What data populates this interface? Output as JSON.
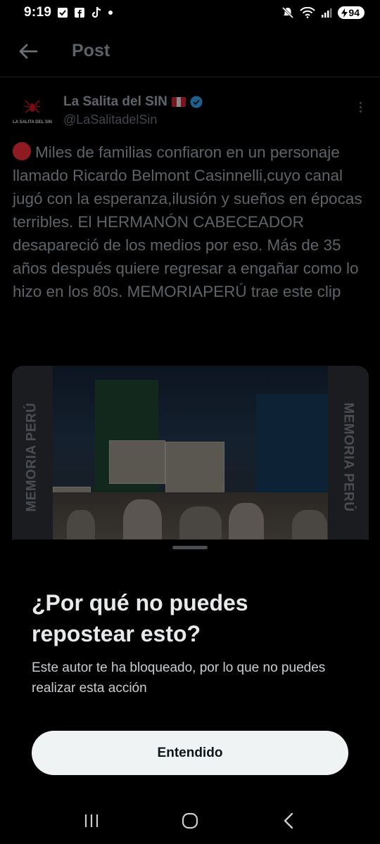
{
  "status_bar": {
    "time": "9:19",
    "battery": "94",
    "icons": [
      "check-box-icon",
      "facebook-icon",
      "tiktok-icon",
      "dot-icon",
      "mute-icon",
      "wifi-icon",
      "signal-icon",
      "battery-icon"
    ]
  },
  "header": {
    "title": "Post",
    "back_icon": "arrow-left-icon"
  },
  "tweet": {
    "author_name": "La Salita del SIN",
    "handle": "@LaSalitadelSin",
    "avatar_text": "LA SALITA DEL SIN",
    "text": "Miles de familias confiaron en un personaje llamado Ricardo Belmont Casinnelli,cuyo canal jugó con la esperanza,ilusión y sueños en épocas terribles. El HERMANÓN CABECEADOR desapareció de los medios por eso. Más de 35 años después quiere regresar a engañar como lo hizo en los 80s. MEMORIAPERÚ trae este clip",
    "media": {
      "side_label_left": "MEMORIA PERÚ",
      "side_label_right": "MEMORIA PERÚ"
    }
  },
  "sheet": {
    "title": "¿Por qué no puedes repostear esto?",
    "body": "Este autor te ha bloqueado, por lo que no puedes realizar esta acción",
    "button_label": "Entendido"
  },
  "nav_bar": {
    "icons": [
      "recent-apps-icon",
      "home-icon",
      "back-icon"
    ]
  },
  "colors": {
    "background": "#000000",
    "verified": "#1d9bf0",
    "button_bg": "#eff3f4",
    "flag_red": "#d91023"
  }
}
